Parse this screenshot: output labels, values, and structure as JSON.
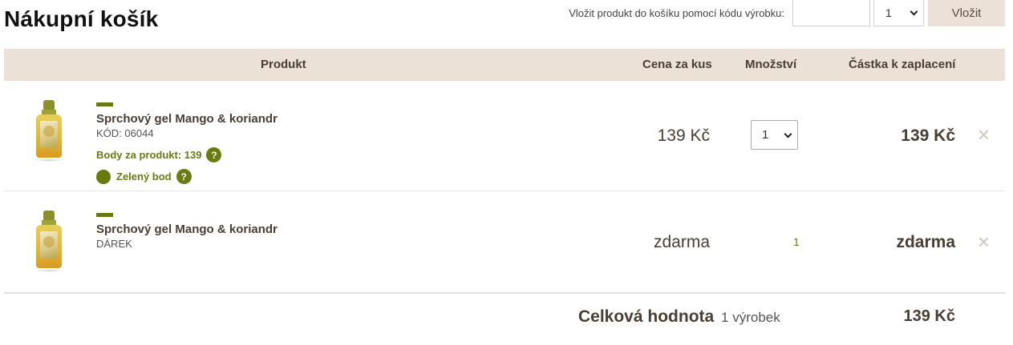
{
  "page": {
    "title": "Nákupní košík"
  },
  "code_form": {
    "label": "Vložit produkt do košíku pomocí kódu výrobku:",
    "code_value": "",
    "qty_value": "1",
    "button_label": "Vložit"
  },
  "table": {
    "headers": {
      "product": "Produkt",
      "price": "Cena za kus",
      "qty": "Množství",
      "total": "Částka k zaplacení"
    }
  },
  "items": [
    {
      "name": "Sprchový gel Mango & koriandr",
      "code": "KÓD: 06044",
      "points": "Body za produkt: 139",
      "green_point": "Zelený bod",
      "price": "139 Kč",
      "quantity": "1",
      "total": "139 Kč",
      "remove": "×"
    },
    {
      "name": "Sprchový gel Mango & koriandr",
      "code": "DÁREK",
      "price": "zdarma",
      "quantity": "1",
      "total": "zdarma",
      "remove": "×"
    }
  ],
  "summary": {
    "label": "Celková hodnota",
    "count": "1 výrobek",
    "total": "139 Kč"
  },
  "icons": {
    "help": "?"
  },
  "colors": {
    "accent_green": "#6a7b13",
    "header_bg": "#ebe1d7",
    "text_brown": "#4a3e34"
  }
}
